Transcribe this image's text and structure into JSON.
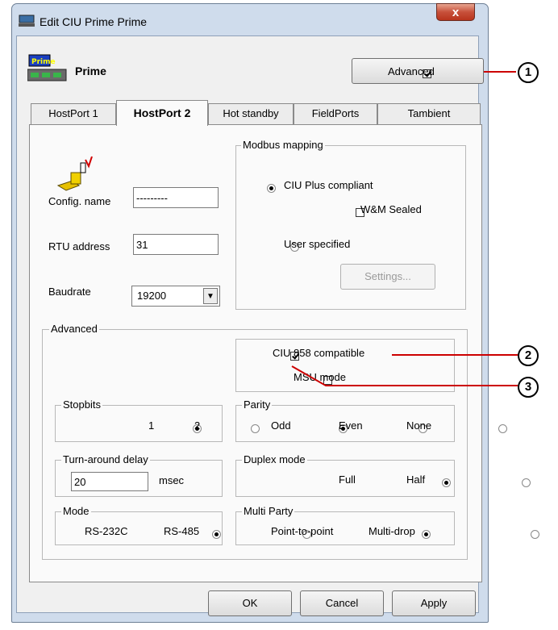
{
  "window": {
    "title": "Edit CIU Prime Prime",
    "close_label": "x"
  },
  "header": {
    "device_name": "Prime",
    "logo_text": "Prime",
    "advanced_toggle": {
      "label": "Advanced",
      "checked": true
    }
  },
  "tabs": [
    {
      "label": "HostPort 1",
      "active": false
    },
    {
      "label": "HostPort 2",
      "active": true
    },
    {
      "label": "Hot standby",
      "active": false
    },
    {
      "label": "FieldPorts",
      "active": false
    },
    {
      "label": "Tambient",
      "active": false
    }
  ],
  "host": {
    "config_name_label": "Config. name",
    "config_name_value": "---------",
    "rtu_label": "RTU address",
    "rtu_value": "31",
    "baud_label": "Baudrate",
    "baud_value": "19200"
  },
  "modbus": {
    "title": "Modbus mapping",
    "ciu_plus_label": "CIU Plus compliant",
    "wm_sealed_label": "W&M Sealed",
    "user_specified_label": "User specified",
    "settings_button": "Settings..."
  },
  "advanced": {
    "title": "Advanced",
    "ciu858_label": "CIU 858 compatible",
    "msu_label": "MSU mode",
    "stopbits": {
      "title": "Stopbits",
      "opt1": "1",
      "opt2": "2"
    },
    "parity": {
      "title": "Parity",
      "odd": "Odd",
      "even": "Even",
      "none": "None"
    },
    "turnaround": {
      "title": "Turn-around delay",
      "value": "20",
      "unit": "msec"
    },
    "duplex": {
      "title": "Duplex mode",
      "full": "Full",
      "half": "Half"
    },
    "mode": {
      "title": "Mode",
      "rs232": "RS-232C",
      "rs485": "RS-485"
    },
    "multiparty": {
      "title": "Multi Party",
      "p2p": "Point-to-point",
      "multidrop": "Multi-drop"
    }
  },
  "buttons": {
    "ok": "OK",
    "cancel": "Cancel",
    "apply": "Apply"
  },
  "callouts": [
    "1",
    "2",
    "3"
  ],
  "colors": {
    "callout_line": "#cc0000",
    "titlebar": "#cfdcec",
    "close": "#c7503a"
  }
}
